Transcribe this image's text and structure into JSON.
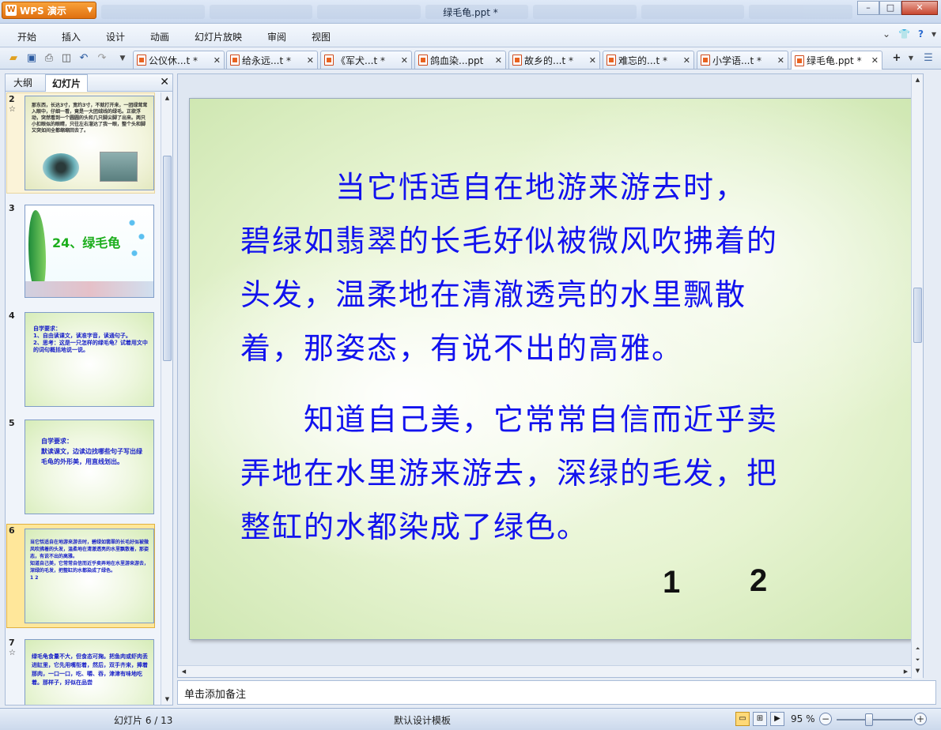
{
  "window": {
    "app_button": "WPS 演示",
    "title": "绿毛龟.ppt *",
    "controls": [
      "–",
      "□",
      "✕"
    ]
  },
  "menu": {
    "items": [
      "开始",
      "插入",
      "设计",
      "动画",
      "幻灯片放映",
      "审阅",
      "视图"
    ]
  },
  "doc_tabs": [
    {
      "label": "公仪休...t *",
      "active": false
    },
    {
      "label": "给永远...t *",
      "active": false
    },
    {
      "label": "《军犬...t *",
      "active": false
    },
    {
      "label": "鸽血染...ppt",
      "active": false
    },
    {
      "label": "故乡的...t *",
      "active": false
    },
    {
      "label": "难忘的...t *",
      "active": false
    },
    {
      "label": "小学语...t *",
      "active": false
    },
    {
      "label": "绿毛龟.ppt *",
      "active": true
    }
  ],
  "left_panel": {
    "tabs": [
      "大纲",
      "幻灯片"
    ],
    "active_tab": "幻灯片",
    "thumbnails": [
      {
        "num": "2",
        "text": "那东西，长达3寸，宽约3寸，不就打开来，一团绿茸茸入眼中，仔细一看，竟是一大团绒线的绿毛。正欲浮动，突然看到一个圆圆的头和几只脚尖脚了出来。两只小扣眼似的眼睛，只往左右溜达了我一眼，整个头和脚又突如间全都缩缩回去了。"
      },
      {
        "num": "3",
        "text": "24、绿毛龟"
      },
      {
        "num": "4",
        "text": "自学要求：\n1、自由读课文，读准字音，读通句子。\n2、思考：这是一只怎样的绿毛龟？试着用文中的词句概括地说一说。"
      },
      {
        "num": "5",
        "text": "自学要求：\n默读课文，边读边找哪些句子写出绿毛龟的外形美，用直线划出。"
      },
      {
        "num": "6",
        "text": "当它恬适自在地游来游去时，碧绿如翡翠的长毛好似被微风吹拂着的头发，温柔地在清澈透亮的水里飘散着，那姿态，有说不出的高雅。\n知道自己美，它常常自信而近乎卖弄地在水里游来游去，深绿的毛发，把整缸的水都染成了绿色。\n1    2"
      },
      {
        "num": "7",
        "text": "绿毛龟食量不大，但食态可掬。把鱼肉或虾肉丢进缸里，它先用嘴衔着，然后，双手齐来，捧着那肉，一口一口，吃、嚼、吞，津津有味地吃着。那样子，好似在品尝"
      }
    ]
  },
  "slide": {
    "paragraph1": "当它恬适自在地游来游去时，碧绿如翡翠的长毛好似被微风吹拂着的头发，温柔地在清澈透亮的水里飘散着，那姿态，有说不出的高雅。",
    "paragraph1_lines": [
      "　　　当它恬适自在地游来游去时，",
      "碧绿如翡翠的长毛好似被微风吹拂着的",
      "头发，温柔地在清澈透亮的水里飘散",
      "着，那姿态，有说不出的高雅。"
    ],
    "paragraph2_lines": [
      "　　知道自己美，它常常自信而近乎卖",
      "弄地在水里游来游去，深绿的毛发，把",
      "整缸的水都染成了绿色。"
    ],
    "markers": [
      "1",
      "2"
    ]
  },
  "notes": {
    "placeholder": "单击添加备注"
  },
  "status": {
    "slide_info": "幻灯片 6 / 13",
    "template": "默认设计模板",
    "zoom": "95 %"
  }
}
